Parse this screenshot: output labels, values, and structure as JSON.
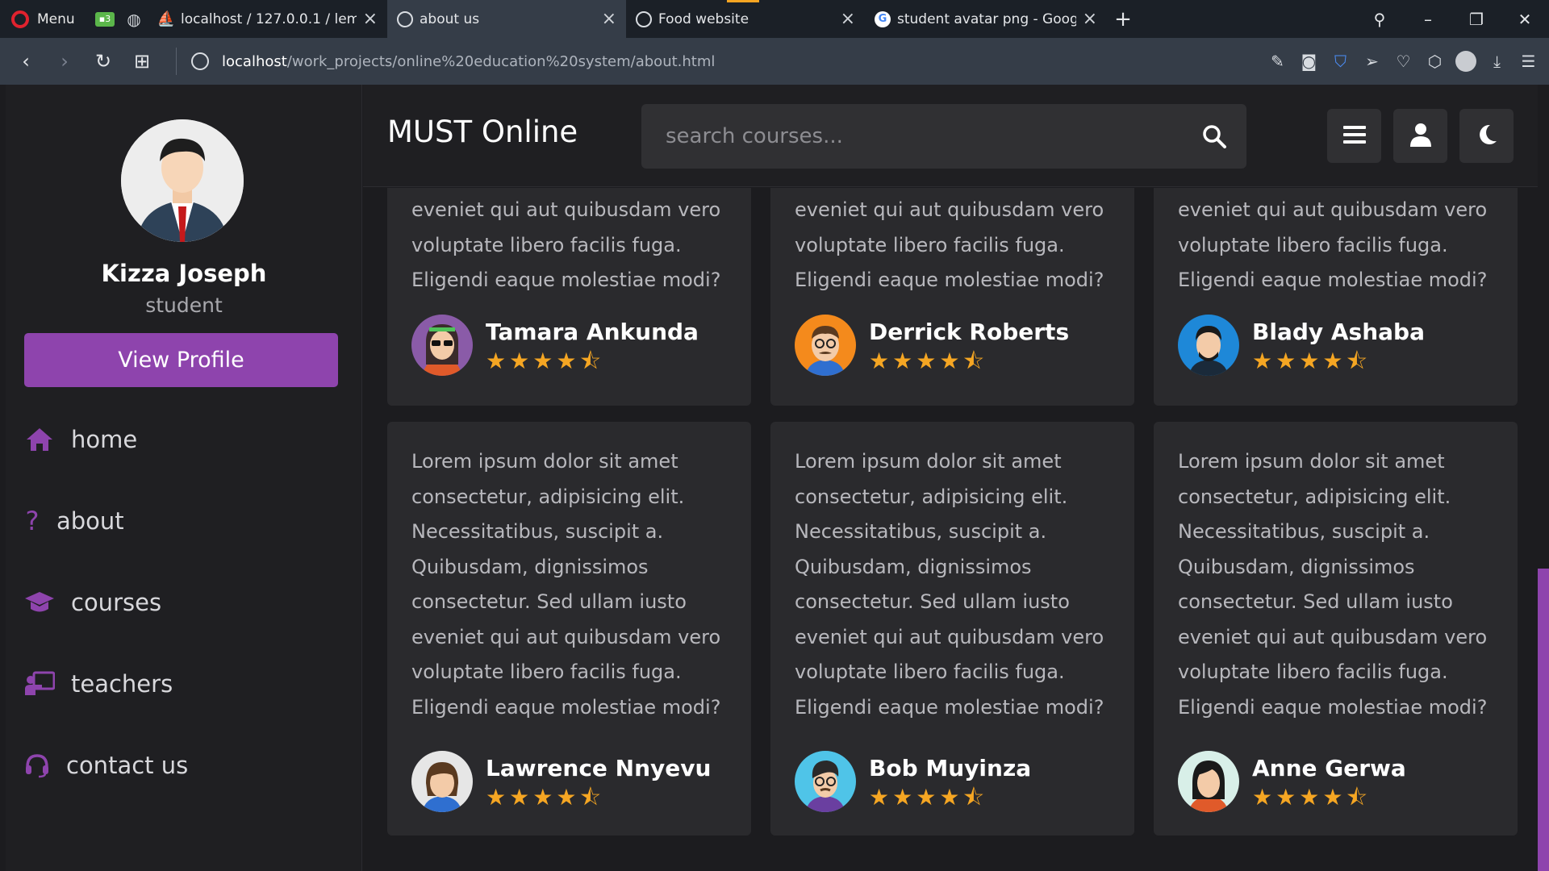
{
  "browser": {
    "menu_label": "Menu",
    "tabs": [
      {
        "title": "localhost / 127.0.0.1 / lemeo",
        "favicon": "phpmyadmin-icon",
        "active": false
      },
      {
        "title": "about us",
        "favicon": "globe-icon",
        "active": true
      },
      {
        "title": "Food website",
        "favicon": "globe-icon",
        "active": false
      },
      {
        "title": "student avatar png - Google",
        "favicon": "google-icon",
        "active": false
      }
    ],
    "url_host": "localhost",
    "url_path": "/work_projects/online%20education%20system/about.html"
  },
  "sidebar": {
    "profile_name": "Kizza Joseph",
    "profile_role": "student",
    "view_profile_label": "View Profile",
    "nav": [
      {
        "label": "home",
        "icon": "home-icon"
      },
      {
        "label": "about",
        "icon": "question-icon"
      },
      {
        "label": "courses",
        "icon": "graduation-cap-icon"
      },
      {
        "label": "teachers",
        "icon": "chalkboard-teacher-icon"
      },
      {
        "label": "contact us",
        "icon": "headset-icon"
      }
    ]
  },
  "header": {
    "logo": "MUST Online",
    "search_placeholder": "search courses..."
  },
  "reviews": {
    "text_partial": "eveniet qui aut quibusdam vero voluptate libero facilis fuga. Eligendi eaque molestiae modi?",
    "text_full": "Lorem ipsum dolor sit amet consectetur, adipisicing elit. Necessitatibus, suscipit a. Quibusdam, dignissimos consectetur. Sed ullam iusto eveniet qui aut quibusdam vero voluptate libero facilis fuga. Eligendi eaque molestiae modi?",
    "rating": 4.5,
    "people": [
      {
        "name": "Tamara Ankunda"
      },
      {
        "name": "Derrick Roberts"
      },
      {
        "name": "Blady Ashaba"
      },
      {
        "name": "Lawrence Nnyevu"
      },
      {
        "name": "Bob Muyinza"
      },
      {
        "name": "Anne Gerwa"
      }
    ]
  },
  "colors": {
    "accent": "#8e44ad",
    "star": "#f5a623",
    "card": "#2a2a2d"
  }
}
